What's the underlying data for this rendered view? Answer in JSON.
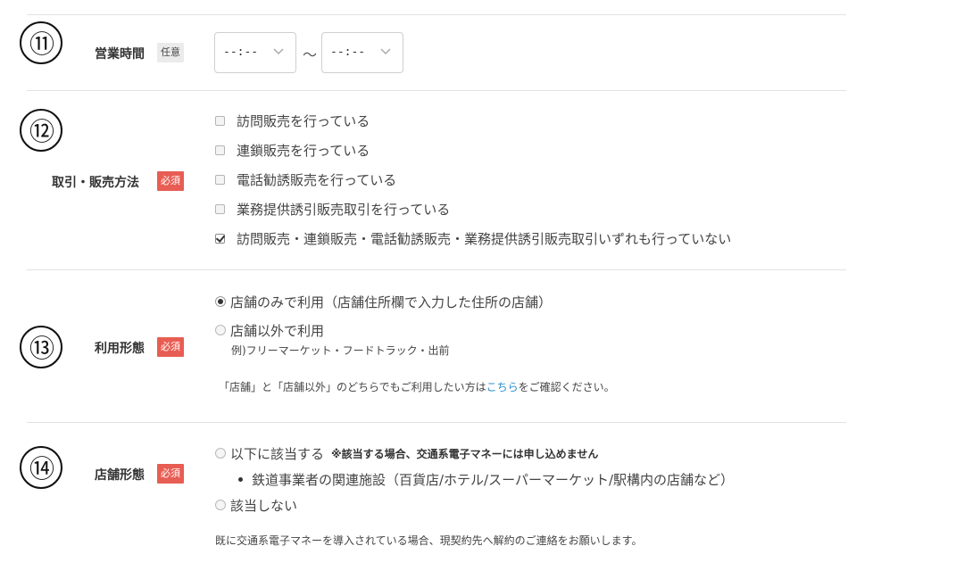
{
  "rows": {
    "hours": {
      "num": "⑪",
      "label": "営業時間",
      "badge": "任意",
      "start_value": "--:--",
      "end_value": "--:--",
      "separator": "～"
    },
    "trade": {
      "num": "⑫",
      "label": "取引・販売方法",
      "badge": "必須",
      "options": [
        {
          "label": "訪問販売を行っている",
          "checked": false
        },
        {
          "label": "連鎖販売を行っている",
          "checked": false
        },
        {
          "label": "電話勧誘販売を行っている",
          "checked": false
        },
        {
          "label": "業務提供誘引販売取引を行っている",
          "checked": false
        },
        {
          "label": "訪問販売・連鎖販売・電話勧誘販売・業務提供誘引販売取引いずれも行っていない",
          "checked": true
        }
      ]
    },
    "usage": {
      "num": "⑬",
      "label": "利用形態",
      "badge": "必須",
      "options": [
        {
          "label": "店舗のみで利用（店舗住所欄で入力した住所の店舗）",
          "checked": true
        },
        {
          "label": "店舗以外で利用",
          "checked": false
        }
      ],
      "example": "例)フリーマーケット・フードトラック・出前",
      "note_before": "「店舗」と「店舗以外」のどちらでもご利用したい方は",
      "note_link": "こちら",
      "note_after": "をご確認ください。"
    },
    "store": {
      "num": "⑭",
      "label": "店舗形態",
      "badge": "必須",
      "options": [
        {
          "label": "以下に該当する",
          "checked": false
        },
        {
          "label": "該当しない",
          "checked": false
        }
      ],
      "warning": "※該当する場合、交通系電子マネーには申し込めません",
      "bullet": "鉄道事業者の関連施設（百貨店/ホテル/スーパーマーケット/駅構内の店舗など）",
      "footer_note": "既に交通系電子マネーを導入されている場合、現契約先へ解約のご連絡をお願いします。"
    }
  }
}
